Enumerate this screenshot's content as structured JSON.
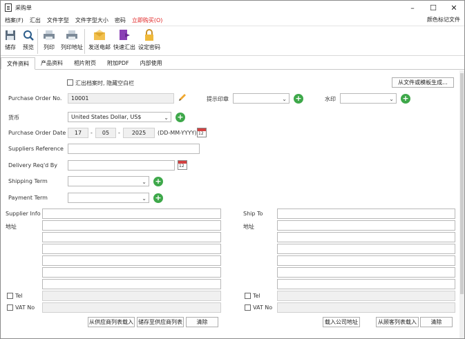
{
  "window": {
    "title": "采购单",
    "minimize": "–",
    "maximize": "☐",
    "close": "✕"
  },
  "menu": {
    "items": [
      "档案(F)",
      "汇出",
      "文件字型",
      "文件字型大小",
      "密码"
    ],
    "buy": "立即购买(O)",
    "right": "颜色标记文件"
  },
  "toolbar": [
    {
      "label": "储存",
      "icon": "save-icon"
    },
    {
      "label": "预览",
      "icon": "preview-icon"
    },
    {
      "label": "列印",
      "icon": "print-icon"
    },
    {
      "label": "列印地址",
      "icon": "print-address-icon"
    },
    {
      "label": "发送电邮",
      "icon": "email-icon"
    },
    {
      "label": "快速汇出",
      "icon": "export-icon"
    },
    {
      "label": "设定密码",
      "icon": "lock-icon"
    }
  ],
  "tabs": [
    "文件资料",
    "产品资料",
    "相片附页",
    "附加PDF",
    "内部使用"
  ],
  "form": {
    "hide_blank_label": "汇出档案时, 隐藏空白栏",
    "generate_btn": "从文件或模板生成...",
    "po_label": "Purchase Order No.",
    "po_value": "10001",
    "stamp_label": "提示印章",
    "watermark_label": "水印",
    "currency_label": "货币",
    "currency_value": "United States Dollar, US$",
    "date_label": "Purchase Order Date",
    "date_day": "17",
    "date_month": "05",
    "date_year": "2025",
    "date_sep": "-",
    "date_format": "(DD-MM-YYYY)",
    "cal_text": "12",
    "supplier_ref_label": "Suppliers Reference",
    "delivery_label": "Delivery Req'd By",
    "shipping_label": "Shipping Term",
    "payment_label": "Payment Term",
    "supplier_info_label": "Supplier Info",
    "address_label": "地址",
    "ship_to_label": "Ship To",
    "tel_label": "Tel",
    "vat_label": "VAT No",
    "load_supplier_btn": "从供应商列表载入",
    "save_supplier_btn": "储存至供应商列表",
    "clear_btn": "清除",
    "load_company_btn": "载入公司地址",
    "load_customer_btn": "从顾客列表载入",
    "plus": "+",
    "caret": "⌄"
  }
}
